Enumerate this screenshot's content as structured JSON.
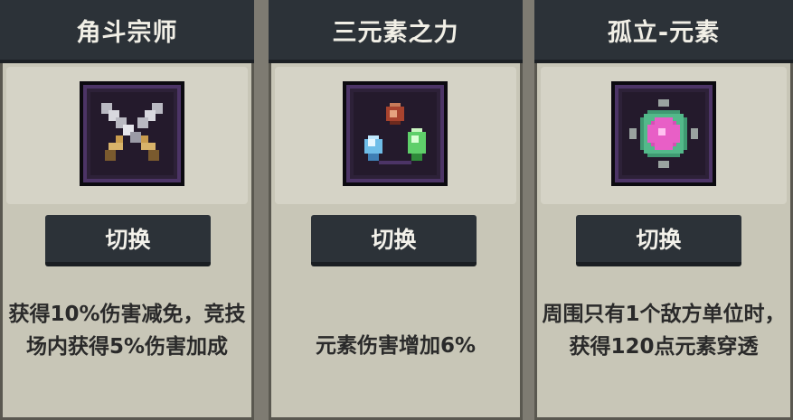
{
  "cards": [
    {
      "title": "角斗宗师",
      "icon": "crossed-swords-icon",
      "button_label": "切换",
      "description": "获得10%伤害减免，竞技场内获得5%伤害加成"
    },
    {
      "title": "三元素之力",
      "icon": "three-elements-icon",
      "button_label": "切换",
      "description": "元素伤害增加6%"
    },
    {
      "title": "孤立-元素",
      "icon": "isolated-element-icon",
      "button_label": "切换",
      "description": "周围只有1个敌方单位时，获得120点元素穿透"
    }
  ],
  "colors": {
    "title_bar": "#2c3238",
    "card_bg": "#c8c6b7",
    "icon_frame": "#4c3466",
    "text": "#2a2a2a"
  }
}
